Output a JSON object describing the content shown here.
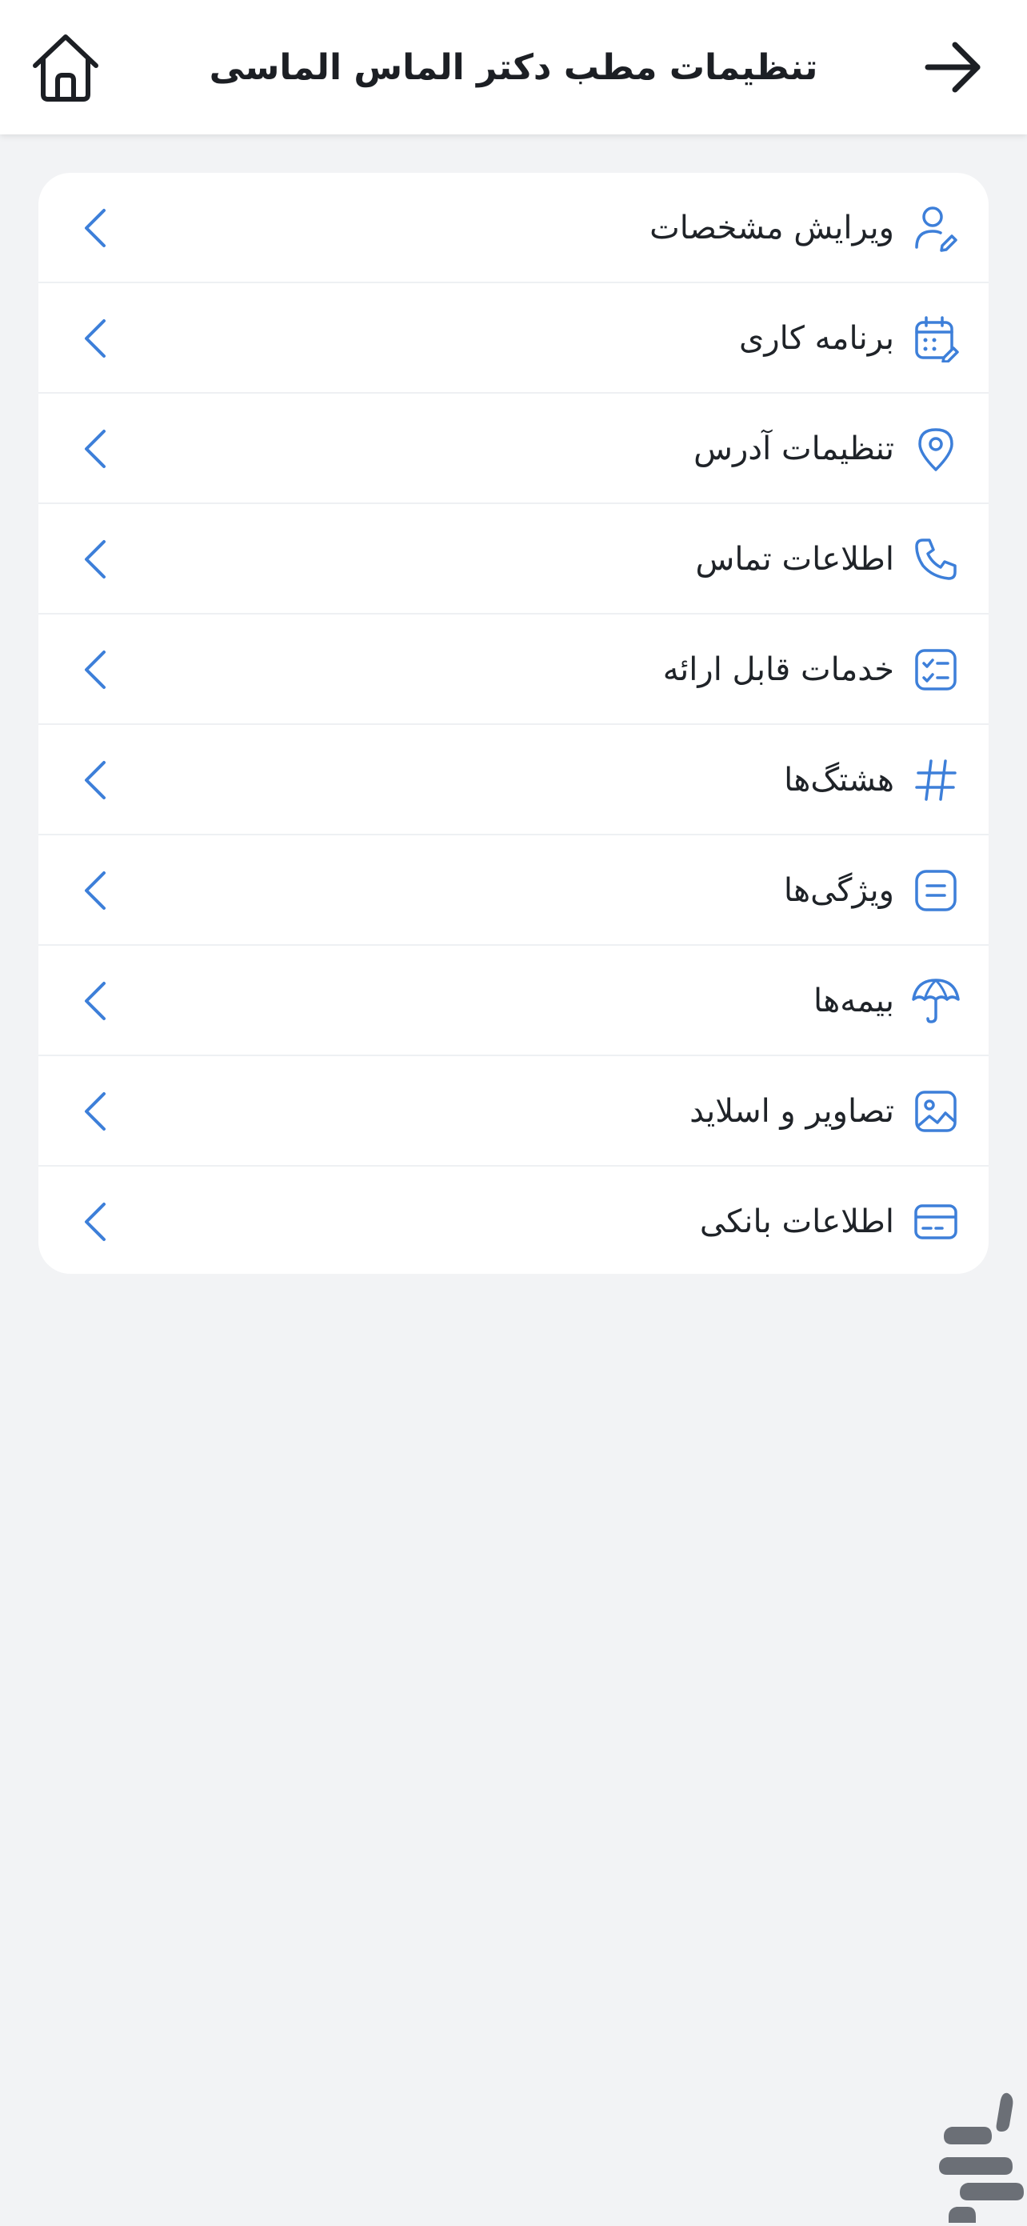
{
  "header": {
    "title": "تنظیمات مطب دکتر الماس الماسی",
    "back_icon": "arrow-right-icon",
    "home_icon": "home-icon"
  },
  "menu": {
    "items": [
      {
        "label": "ویرایش مشخصات",
        "icon": "user-edit-icon"
      },
      {
        "label": "برنامه کاری",
        "icon": "calendar-edit-icon"
      },
      {
        "label": "تنظیمات آدرس",
        "icon": "location-pin-icon"
      },
      {
        "label": "اطلاعات تماس",
        "icon": "phone-icon"
      },
      {
        "label": "خدمات قابل ارائه",
        "icon": "checklist-icon"
      },
      {
        "label": "هشتگ‌ها",
        "icon": "hashtag-icon"
      },
      {
        "label": "ویژگی‌ها",
        "icon": "features-list-icon"
      },
      {
        "label": "بیمه‌ها",
        "icon": "umbrella-icon"
      },
      {
        "label": "تصاویر و اسلاید",
        "icon": "image-icon"
      },
      {
        "label": "اطلاعات بانکی",
        "icon": "bank-card-icon"
      }
    ],
    "chevron_icon": "chevron-left-icon"
  },
  "colors": {
    "accent": "#3d7fd9",
    "text": "#1f2328",
    "background": "#f2f3f5",
    "card": "#ffffff",
    "watermark": "#6b6f76"
  },
  "watermark_icon": "cafebazaar-logo-icon"
}
